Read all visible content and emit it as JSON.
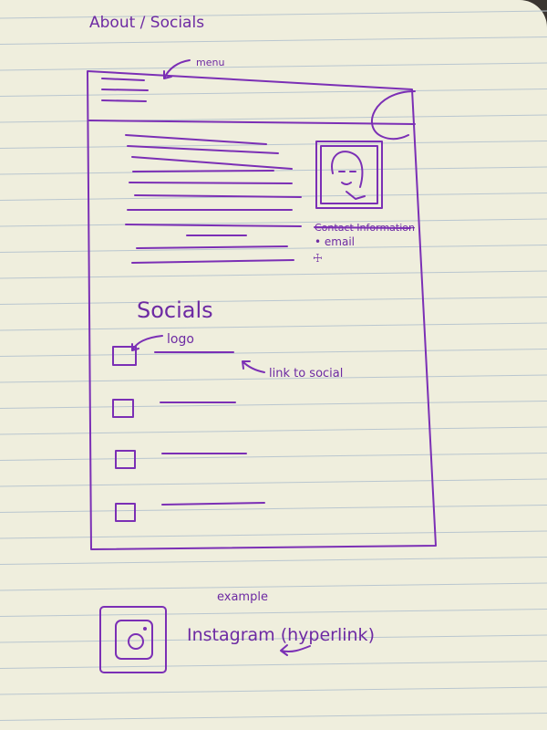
{
  "page_title": "About / Socials",
  "annotations": {
    "menu": "menu",
    "logo": "logo",
    "link_to_social": "link to social",
    "example": "example"
  },
  "contact": {
    "heading": "Contact Information",
    "items": [
      "• email"
    ]
  },
  "socials": {
    "heading": "Socials",
    "item_count": 4
  },
  "example": {
    "label": "Instagram (hyperlink)",
    "icon": "instagram-icon"
  },
  "colors": {
    "ink": "#7b2fb5",
    "paper": "#efeedd",
    "rule_lines": "#b9c6cf"
  }
}
